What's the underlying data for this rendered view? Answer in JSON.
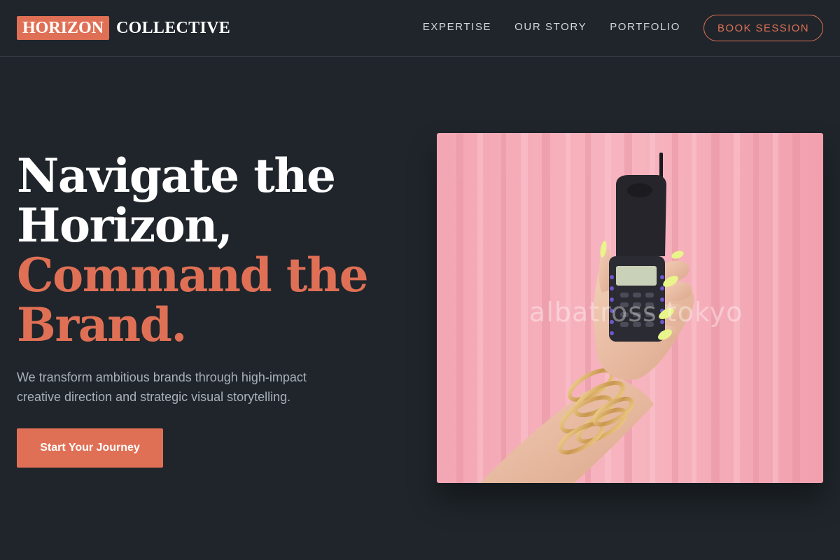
{
  "brand": {
    "badge": "HORIZON",
    "name": "COLLECTIVE"
  },
  "nav": {
    "items": [
      {
        "label": "EXPERTISE"
      },
      {
        "label": "OUR STORY"
      },
      {
        "label": "PORTFOLIO"
      }
    ],
    "book_label": "BOOK SESSION"
  },
  "hero": {
    "headline_lines": [
      {
        "text": "Navigate the"
      },
      {
        "text": "Horizon,"
      },
      {
        "text": "Command the"
      },
      {
        "text": "Brand."
      }
    ],
    "subtext": "We transform ambitious brands through high-impact creative direction and strategic visual storytelling.",
    "cta_label": "Start Your Journey",
    "image": {
      "icon": "hand-holding-flip-phone-image",
      "watermark": "albatross tokyo"
    }
  },
  "colors": {
    "background": "#1f252b",
    "accent": "#e07055",
    "muted_text": "#a9b0b8",
    "image_backdrop": "#f4a7b4"
  }
}
